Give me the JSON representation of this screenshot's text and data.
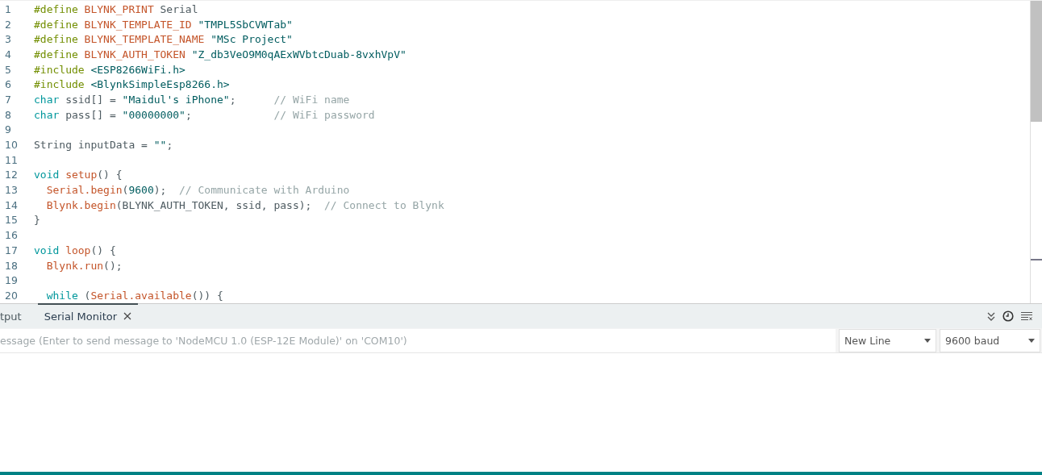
{
  "editor": {
    "lines": [
      {
        "number": "1",
        "tokens": [
          {
            "t": "#define",
            "color": "#728e00"
          },
          {
            "t": " BLYNK_PRINT",
            "color": "#c4552a"
          },
          {
            "t": " Serial"
          }
        ]
      },
      {
        "number": "2",
        "tokens": [
          {
            "t": "#define",
            "color": "#728e00"
          },
          {
            "t": " BLYNK_TEMPLATE_ID",
            "color": "#c4552a"
          },
          {
            "t": " \"TMPL5SbCVWTab\"",
            "color": "#005c5f"
          }
        ]
      },
      {
        "number": "3",
        "tokens": [
          {
            "t": "#define",
            "color": "#728e00"
          },
          {
            "t": " BLYNK_TEMPLATE_NAME",
            "color": "#c4552a"
          },
          {
            "t": " \"MSc Project\"",
            "color": "#005c5f"
          }
        ]
      },
      {
        "number": "4",
        "tokens": [
          {
            "t": "#define",
            "color": "#728e00"
          },
          {
            "t": " BLYNK_AUTH_TOKEN",
            "color": "#c4552a"
          },
          {
            "t": " \"Z_db3VeO9M0qAExWVbtcDuab-8vxhVpV\"",
            "color": "#005c5f"
          }
        ]
      },
      {
        "number": "5",
        "tokens": [
          {
            "t": "#include",
            "color": "#728e00"
          },
          {
            "t": " <ESP8266WiFi.h>",
            "color": "#005c5f"
          }
        ]
      },
      {
        "number": "6",
        "tokens": [
          {
            "t": "#include",
            "color": "#728e00"
          },
          {
            "t": " <BlynkSimpleEsp8266.h>",
            "color": "#005c5f"
          }
        ]
      },
      {
        "number": "7",
        "tokens": [
          {
            "t": "char",
            "color": "#00979c"
          },
          {
            "t": " ssid[] = "
          },
          {
            "t": "\"Maidul's iPhone\"",
            "color": "#005c5f"
          },
          {
            "t": ";      "
          },
          {
            "t": "// WiFi name",
            "color": "#95a5a6"
          }
        ]
      },
      {
        "number": "8",
        "tokens": [
          {
            "t": "char",
            "color": "#00979c"
          },
          {
            "t": " pass[] = "
          },
          {
            "t": "\"00000000\"",
            "color": "#005c5f"
          },
          {
            "t": ";             "
          },
          {
            "t": "// WiFi password",
            "color": "#95a5a6"
          }
        ]
      },
      {
        "number": "9"
      },
      {
        "number": "10",
        "tokens": [
          {
            "t": "String inputData = "
          },
          {
            "t": "\"\"",
            "color": "#005c5f"
          },
          {
            "t": ";"
          }
        ]
      },
      {
        "number": "11"
      },
      {
        "number": "12",
        "tokens": [
          {
            "t": "void",
            "color": "#00979c"
          },
          {
            "t": " setup",
            "color": "#c4552a"
          },
          {
            "t": "() {"
          }
        ]
      },
      {
        "number": "13",
        "tokens": [
          {
            "t": "  Serial.begin",
            "color": "#c4552a"
          },
          {
            "t": "("
          },
          {
            "t": "9600",
            "color": "#005c5f"
          },
          {
            "t": ");  "
          },
          {
            "t": "// Communicate with Arduino",
            "color": "#95a5a6"
          }
        ]
      },
      {
        "number": "14",
        "tokens": [
          {
            "t": "  Blynk.begin",
            "color": "#c4552a"
          },
          {
            "t": "(BLYNK_AUTH_TOKEN, ssid, pass);  "
          },
          {
            "t": "// Connect to Blynk",
            "color": "#95a5a6"
          }
        ]
      },
      {
        "number": "15",
        "tokens": [
          {
            "t": "}"
          }
        ]
      },
      {
        "number": "16"
      },
      {
        "number": "17",
        "tokens": [
          {
            "t": "void",
            "color": "#00979c"
          },
          {
            "t": " loop",
            "color": "#c4552a"
          },
          {
            "t": "() {"
          }
        ]
      },
      {
        "number": "18",
        "tokens": [
          {
            "t": "  Blynk.run",
            "color": "#c4552a"
          },
          {
            "t": "();"
          }
        ]
      },
      {
        "number": "19"
      },
      {
        "number": "20",
        "tokens": [
          {
            "t": "  while",
            "color": "#00979c"
          },
          {
            "t": " ("
          },
          {
            "t": "Serial.available",
            "color": "#c4552a"
          },
          {
            "t": "()) {"
          }
        ]
      }
    ]
  },
  "panel": {
    "tabs": [
      {
        "label": "tput",
        "selected": false
      },
      {
        "label": "Serial Monitor",
        "selected": true
      }
    ],
    "message_field": {
      "placeholder": "essage (Enter to send message to 'NodeMCU 1.0 (ESP-12E Module)' on 'COM10')"
    },
    "line_ending": "New Line",
    "baud_rate": "9600 baud"
  }
}
